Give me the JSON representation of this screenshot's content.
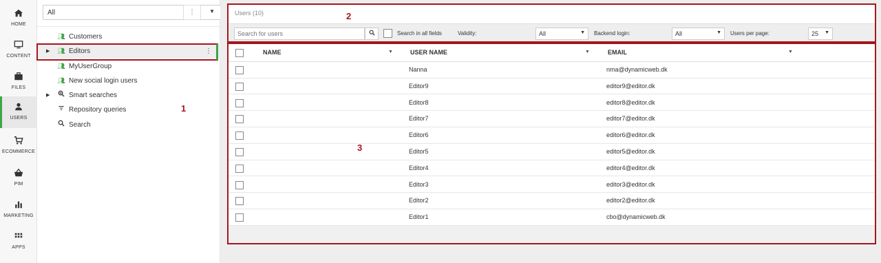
{
  "rail": {
    "items": [
      {
        "label": "HOME",
        "icon": "home-icon"
      },
      {
        "label": "CONTENT",
        "icon": "monitor-icon"
      },
      {
        "label": "FILES",
        "icon": "briefcase-icon"
      },
      {
        "label": "USERS",
        "icon": "user-icon",
        "active": true
      },
      {
        "label": "ECOMMERCE",
        "icon": "cart-icon"
      },
      {
        "label": "PIM",
        "icon": "basket-icon"
      },
      {
        "label": "MARKETING",
        "icon": "bar-chart-icon"
      },
      {
        "label": "APPS",
        "icon": "apps-grid-icon"
      }
    ]
  },
  "tree": {
    "filter_value": "All",
    "items": [
      {
        "label": "Customers",
        "icon": "user-group-icon",
        "arrow": false
      },
      {
        "label": "Editors",
        "icon": "user-group-icon",
        "arrow": true,
        "selected": true
      },
      {
        "label": "MyUserGroup",
        "icon": "user-group-icon",
        "arrow": false
      },
      {
        "label": "New social login users",
        "icon": "user-group-icon",
        "arrow": false
      },
      {
        "label": "Smart searches",
        "icon": "smart-search-icon",
        "arrow": true
      },
      {
        "label": "Repository queries",
        "icon": "filter-icon",
        "arrow": false
      },
      {
        "label": "Search",
        "icon": "search-icon",
        "arrow": false
      }
    ]
  },
  "toolbar": {
    "title": "Users (10)",
    "search_placeholder": "Search for users",
    "search_all_label": "Search in all fields",
    "validity_label": "Validity:",
    "validity_value": "All",
    "backend_login_label": "Backend login:",
    "backend_login_value": "All",
    "users_per_page_label": "Users per page:",
    "users_per_page_value": "25"
  },
  "grid": {
    "columns": [
      "NAME",
      "USER NAME",
      "EMAIL"
    ],
    "rows": [
      {
        "name": "",
        "username": "Nanna",
        "email": "nma@dynamicweb.dk"
      },
      {
        "name": "",
        "username": "Editor9",
        "email": "editor9@editor.dk"
      },
      {
        "name": "",
        "username": "Editor8",
        "email": "editor8@editor.dk"
      },
      {
        "name": "",
        "username": "Editor7",
        "email": "editor7@editor.dk"
      },
      {
        "name": "",
        "username": "Editor6",
        "email": "editor6@editor.dk"
      },
      {
        "name": "",
        "username": "Editor5",
        "email": "editor5@editor.dk"
      },
      {
        "name": "",
        "username": "Editor4",
        "email": "editor4@editor.dk"
      },
      {
        "name": "",
        "username": "Editor3",
        "email": "editor3@editor.dk"
      },
      {
        "name": "",
        "username": "Editor2",
        "email": "editor2@editor.dk"
      },
      {
        "name": "",
        "username": "Editor1",
        "email": "cbo@dynamicweb.dk"
      }
    ]
  },
  "callouts": [
    "1",
    "2",
    "3"
  ],
  "colors": {
    "accent_green": "#3fa447",
    "callout_red": "#a5161d"
  }
}
